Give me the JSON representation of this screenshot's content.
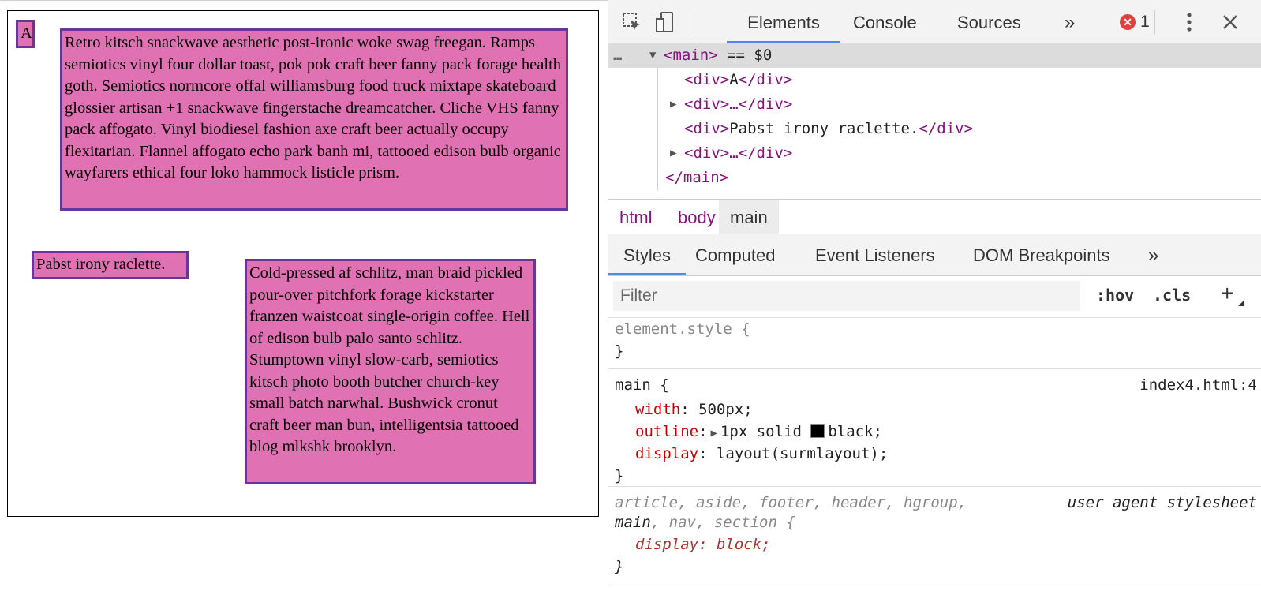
{
  "page": {
    "box_a": "A",
    "box_b": "Retro kitsch snackwave aesthetic post-ironic woke swag freegan. Ramps semiotics vinyl four dollar toast, pok pok craft beer fanny pack forage health goth. Semiotics normcore offal williamsburg food truck mixtape skateboard glossier artisan +1 snackwave fingerstache dreamcatcher. Cliche VHS fanny pack affogato. Vinyl biodiesel fashion axe craft beer actually occupy flexitarian. Flannel affogato echo park banh mi, tattooed edison bulb organic wayfarers ethical four loko hammock listicle prism.",
    "box_c": "Pabst irony raclette.",
    "box_d": "Cold-pressed af schlitz, man braid pickled pour-over pitchfork forage kickstarter franzen waistcoat single-origin coffee. Hell of edison bulb palo santo schlitz. Stumptown vinyl slow-carb, semiotics kitsch photo booth butcher church-key small batch narwhal. Bushwick cronut craft beer man bun, intelligentsia tattooed blog mlkshk brooklyn.",
    "colors": {
      "box_fill": "#e072b3",
      "box_border": "#6a3596"
    }
  },
  "devtools": {
    "tabs": {
      "elements": "Elements",
      "console": "Console",
      "sources": "Sources",
      "more": "»"
    },
    "error_count": "1",
    "icons": {
      "inspect": "element-picker-icon",
      "device": "device-toolbar-icon",
      "kebab": "kebab-menu-icon",
      "close": "close-icon"
    },
    "dom": {
      "dots": "…",
      "main_open": "<main>",
      "main_marker": "== $0",
      "div_a_open": "<div>",
      "div_a_text": "A",
      "div_a_close": "</div>",
      "collapsed": "<div>…</div>",
      "div_c_open": "<div>",
      "div_c_text": "Pabst irony raclette.",
      "div_c_close": "</div>",
      "main_close": "</main>"
    },
    "breadcrumbs": [
      "html",
      "body",
      "main"
    ],
    "subtabs": {
      "styles": "Styles",
      "computed": "Computed",
      "events": "Event Listeners",
      "dom_breakpoints": "DOM Breakpoints",
      "more": "»"
    },
    "filter_placeholder": "Filter",
    "hov": ":hov",
    "cls": ".cls",
    "plus": "+",
    "rules": {
      "element_style": {
        "selector": "element.style {",
        "close": "}"
      },
      "main_rule": {
        "selector": "main {",
        "source": "index4.html:4",
        "width_prop": "width",
        "width_val": "500px;",
        "outline_prop": "outline",
        "outline_val_a": "1px solid ",
        "outline_val_b": "black;",
        "display_prop": "display",
        "display_val": "layout(surmlayout);",
        "close": "}"
      },
      "ua_rule": {
        "selector_line1": "article, aside, footer, header, hgroup,",
        "selector_line2_a": "main",
        "selector_line2_b": ", nav, section {",
        "source": "user agent stylesheet",
        "decl": "display: block;",
        "close": "}"
      }
    }
  }
}
